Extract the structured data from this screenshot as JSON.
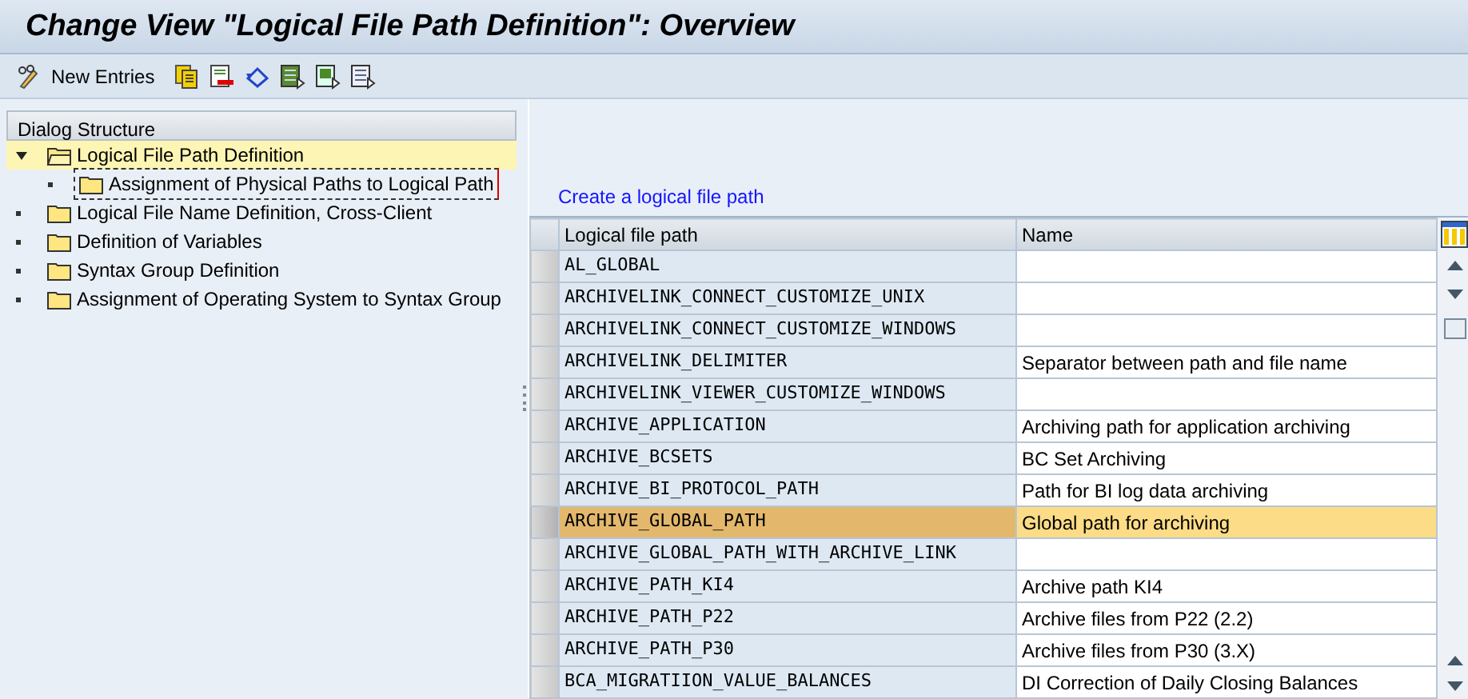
{
  "window": {
    "title": "Change View \"Logical File Path Definition\": Overview"
  },
  "toolbar": {
    "new_entries": "New Entries"
  },
  "dialog_structure": {
    "title": "Dialog Structure",
    "items": [
      {
        "label": "Logical File Path Definition",
        "selected": true,
        "expanded": true,
        "focused": false,
        "children": [
          {
            "label": "Assignment of Physical Paths to Logical Path",
            "selected": false,
            "expanded": false,
            "focused": true
          }
        ]
      },
      {
        "label": "Logical File Name Definition, Cross-Client",
        "selected": false,
        "expanded": false,
        "focused": false
      },
      {
        "label": "Definition of Variables",
        "selected": false,
        "expanded": false,
        "focused": false
      },
      {
        "label": "Syntax Group Definition",
        "selected": false,
        "expanded": false,
        "focused": false
      },
      {
        "label": "Assignment of Operating System to Syntax Group",
        "selected": false,
        "expanded": false,
        "focused": false
      }
    ]
  },
  "link": "Create a logical file path",
  "table": {
    "columns": [
      "Logical file path",
      "Name"
    ],
    "rows": [
      {
        "path": "AL_GLOBAL",
        "name": "",
        "selected": false
      },
      {
        "path": "ARCHIVELINK_CONNECT_CUSTOMIZE_UNIX",
        "name": "",
        "selected": false
      },
      {
        "path": "ARCHIVELINK_CONNECT_CUSTOMIZE_WINDOWS",
        "name": "",
        "selected": false
      },
      {
        "path": "ARCHIVELINK_DELIMITER",
        "name": "Separator between path and file name",
        "selected": false
      },
      {
        "path": "ARCHIVELINK_VIEWER_CUSTOMIZE_WINDOWS",
        "name": "",
        "selected": false
      },
      {
        "path": "ARCHIVE_APPLICATION",
        "name": "Archiving path for application archiving",
        "selected": false
      },
      {
        "path": "ARCHIVE_BCSETS",
        "name": "BC Set Archiving",
        "selected": false
      },
      {
        "path": "ARCHIVE_BI_PROTOCOL_PATH",
        "name": "Path for BI log data archiving",
        "selected": false
      },
      {
        "path": "ARCHIVE_GLOBAL_PATH",
        "name": "Global path for archiving",
        "selected": true
      },
      {
        "path": "ARCHIVE_GLOBAL_PATH_WITH_ARCHIVE_LINK",
        "name": "",
        "selected": false
      },
      {
        "path": "ARCHIVE_PATH_KI4",
        "name": "Archive path KI4",
        "selected": false
      },
      {
        "path": "ARCHIVE_PATH_P22",
        "name": "Archive files from P22 (2.2)",
        "selected": false
      },
      {
        "path": "ARCHIVE_PATH_P30",
        "name": "Archive files from P30 (3.X)",
        "selected": false
      },
      {
        "path": "BCA_MIGRATIION_VALUE_BALANCES",
        "name": "DI Correction of Daily Closing Balances",
        "selected": false
      }
    ]
  }
}
